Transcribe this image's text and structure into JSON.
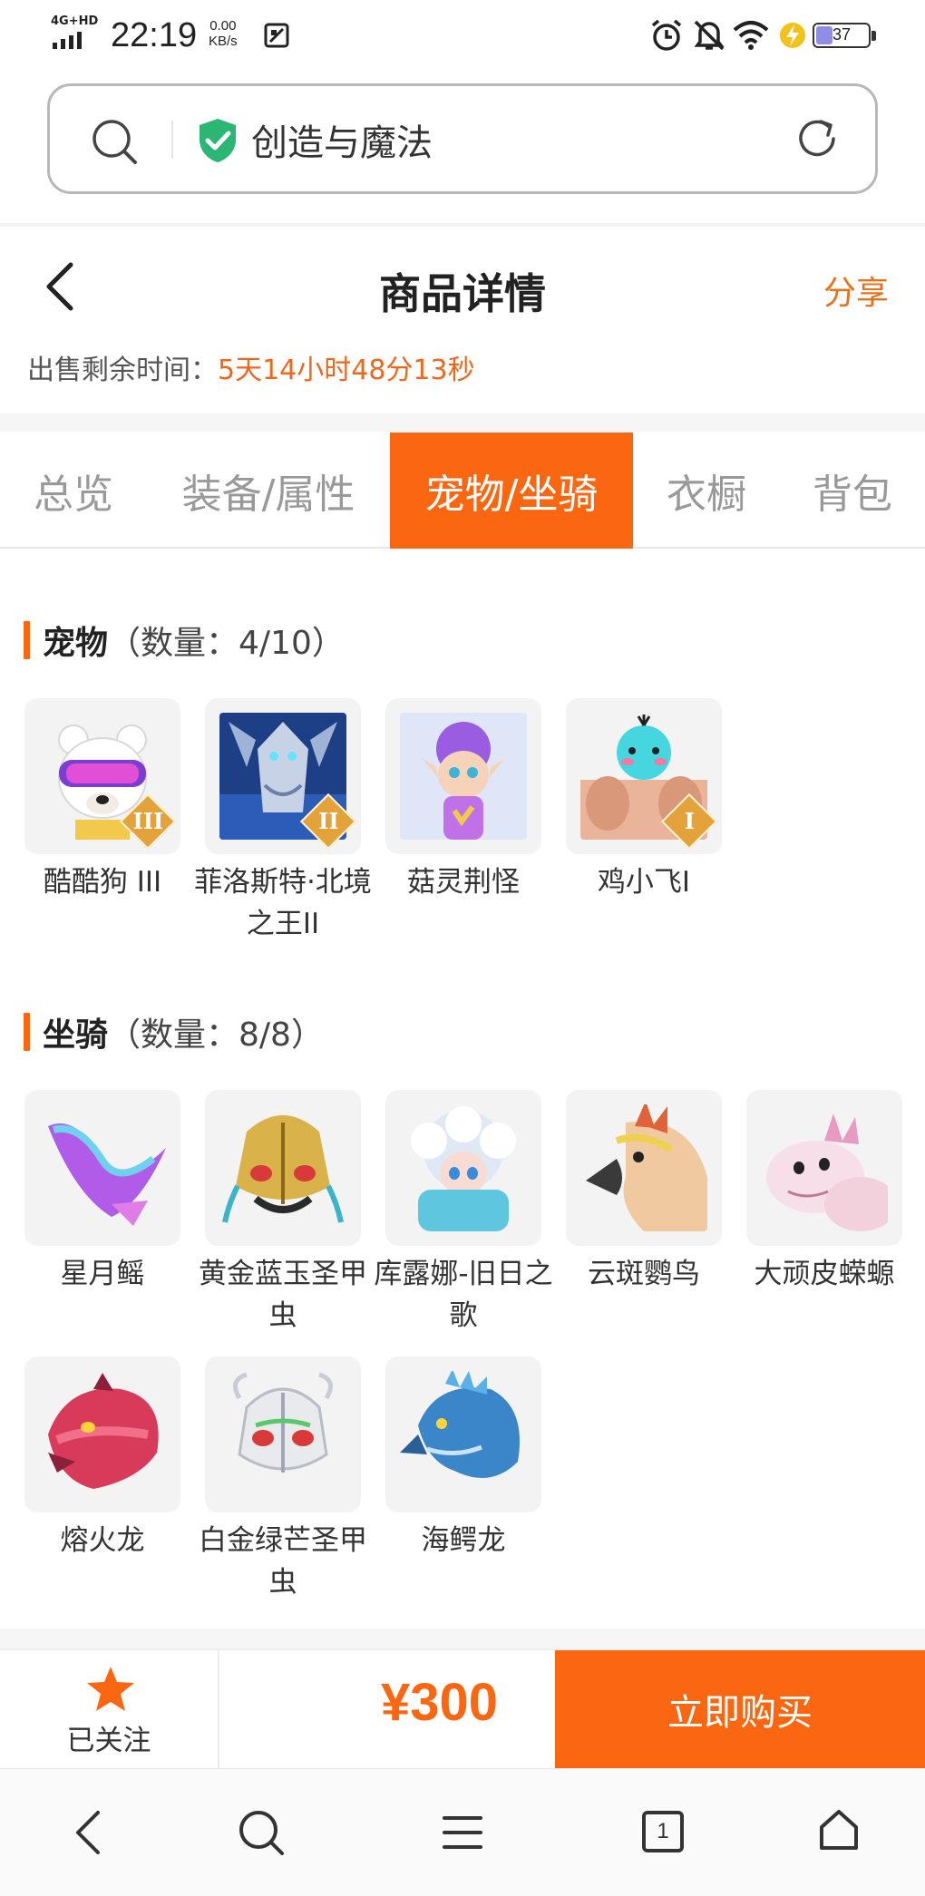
{
  "status_bar": {
    "network": "4G+HD",
    "time": "22:19",
    "speed_value": "0.00",
    "speed_unit": "KB/s",
    "battery": "37",
    "battery_level_percent": 37,
    "icons": [
      "signal-icon",
      "screenshot-icon",
      "alarm-icon",
      "mute-icon",
      "wifi-icon",
      "charging-icon",
      "battery-icon"
    ]
  },
  "address_bar": {
    "title": "创造与魔法",
    "icons": [
      "search-icon",
      "verified-shield-icon",
      "refresh-icon"
    ]
  },
  "header": {
    "title": "商品详情",
    "share_label": "分享",
    "timer_label": "出售剩余时间：",
    "timer_value": "5天14小时48分13秒"
  },
  "tabs": [
    {
      "label": "总览",
      "active": false
    },
    {
      "label": "装备/属性",
      "active": false
    },
    {
      "label": "宠物/坐骑",
      "active": true
    },
    {
      "label": "衣橱",
      "active": false
    },
    {
      "label": "背包",
      "active": false
    }
  ],
  "pets": {
    "title": "宠物",
    "count": "（数量：4/10）",
    "items": [
      {
        "name": "酷酷狗 III",
        "badge": "III"
      },
      {
        "name": "菲洛斯特·北境之王II",
        "badge": "II"
      },
      {
        "name": "菇灵荆怪",
        "badge": ""
      },
      {
        "name": "鸡小飞I",
        "badge": "I"
      }
    ]
  },
  "mounts": {
    "title": "坐骑",
    "count": "（数量：8/8）",
    "items": [
      {
        "name": "星月鳐"
      },
      {
        "name": "黄金蓝玉圣甲虫"
      },
      {
        "name": "库露娜-旧日之歌"
      },
      {
        "name": "云斑鹦鸟"
      },
      {
        "name": "大顽皮蝾螈"
      },
      {
        "name": "熔火龙"
      },
      {
        "name": "白金绿芒圣甲虫"
      },
      {
        "name": "海鳄龙"
      }
    ]
  },
  "action_bar": {
    "follow_label": "已关注",
    "price": "¥300",
    "buy_label": "立即购买"
  },
  "bottom_nav": {
    "icons": [
      "back-icon",
      "search-icon",
      "menu-icon",
      "tabs-icon",
      "home-icon"
    ],
    "tab_count": "1"
  },
  "colors": {
    "accent": "#fa6710",
    "share": "#e8721c",
    "verified": "#2bb673"
  }
}
